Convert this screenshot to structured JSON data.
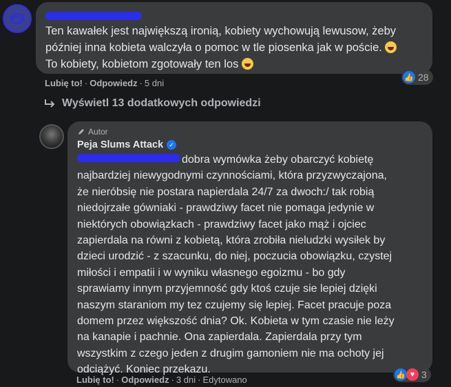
{
  "comment1": {
    "text_line1": "Ten kawałek jest największą ironią, kobiety wychowują lewusow, żeby",
    "text_line2": "później inna kobieta walczyła o pomoc w tle piosenka jak w poście.",
    "text_line3": "To kobiety, kobietom zgotowały ten los",
    "like_label": "Lubię to!",
    "reply_label": "Odpowiedz",
    "time": "5 dni",
    "reaction_count": "28"
  },
  "more_replies_label": "Wyświetl 13 dodatkowych odpowiedzi",
  "comment2": {
    "badge": "Autor",
    "author": "Peja Slums Attack",
    "lines": [
      "dobra wymówka żeby obarczyć kobietę",
      "najbardziej niewygodnymi czynnościami, która przyzwyczajona,",
      "że nieróbsię nie postara napierdala 24/7 za dwoch:/ tak robią",
      "niedojrzałe gówniaki - prawdziwy facet nie pomaga jedynie w",
      "niektórych obowiązkach - prawdziwy facet jako mąż i ojciec",
      "zapierdala na równi z kobietą, która zrobiła nieludzki wysiłek by",
      "dzieci urodzić - z szacunku, do niej, poczucia obowiązku, czystej",
      "miłości i empatii i w wyniku własnego egoizmu - bo gdy",
      "sprawiamy innym przyjemność gdy ktoś czuje sie lepiej dzięki",
      "naszym staraniom my tez czujemy się lepiej. Facet pracuje poza",
      "domem przez większość dnia? Ok. Kobieta w tym czasie nie leży",
      "na kanapie i pachnie. Ona zapierdala. Zapierdala przy tym",
      "wszystkim z czego jeden z drugim gamoniem nie ma ochoty jej",
      "odciążyć. Koniec przekazu."
    ],
    "like_label": "Lubię to!",
    "reply_label": "Odpowiedz",
    "time": "3 dni",
    "edited": "Edytowano",
    "reaction_count": "3"
  },
  "colors": {
    "background": "#18191a",
    "bubble": "#3a3b3c",
    "text": "#e4e6eb",
    "secondary": "#b0b3b8",
    "like_blue": "#1877f2",
    "heart_red": "#f33e58",
    "redaction": "#2b2bff"
  }
}
